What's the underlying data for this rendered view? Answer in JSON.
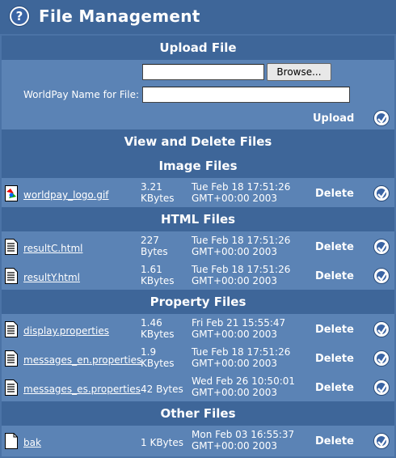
{
  "header": {
    "title": "File Management",
    "help_icon": "?"
  },
  "upload": {
    "section_title": "Upload File",
    "browse_label": "Browse...",
    "name_label": "WorldPay Name for File:",
    "upload_label": "Upload"
  },
  "view": {
    "section_title": "View and Delete Files"
  },
  "groups": [
    {
      "title": "Image Files",
      "files": [
        {
          "name": "worldpay_logo.gif",
          "size": "3.21",
          "unit": "KBytes",
          "date1": "Tue Feb 18 17:51:26",
          "date2": "GMT+00:00 2003",
          "action": "Delete",
          "icon": "image-file-icon"
        }
      ]
    },
    {
      "title": "HTML Files",
      "files": [
        {
          "name": "resultC.html",
          "size": "227",
          "unit": "Bytes",
          "date1": "Tue Feb 18 17:51:26",
          "date2": "GMT+00:00 2003",
          "action": "Delete",
          "icon": "text-file-icon"
        },
        {
          "name": "resultY.html",
          "size": "1.61",
          "unit": "KBytes",
          "date1": "Tue Feb 18 17:51:26",
          "date2": "GMT+00:00 2003",
          "action": "Delete",
          "icon": "text-file-icon"
        }
      ]
    },
    {
      "title": "Property Files",
      "files": [
        {
          "name": "display.properties",
          "size": "1.46",
          "unit": "KBytes",
          "date1": "Fri Feb 21 15:55:47",
          "date2": "GMT+00:00 2003",
          "action": "Delete",
          "icon": "text-file-icon"
        },
        {
          "name": "messages_en.properties",
          "size": "1.9",
          "unit": "KBytes",
          "date1": "Tue Feb 18 17:51:26",
          "date2": "GMT+00:00 2003",
          "action": "Delete",
          "icon": "text-file-icon"
        },
        {
          "name": "messages_es.properties",
          "size": "42 Bytes",
          "unit": "",
          "date1": "Wed Feb 26 10:50:01",
          "date2": "GMT+00:00 2003",
          "action": "Delete",
          "icon": "text-file-icon"
        }
      ]
    },
    {
      "title": "Other Files",
      "files": [
        {
          "name": "bak",
          "size": "1 KBytes",
          "unit": "",
          "date1": "Mon Feb 03 16:55:37",
          "date2": "GMT+00:00 2003",
          "action": "Delete",
          "icon": "blank-file-icon"
        }
      ]
    }
  ]
}
